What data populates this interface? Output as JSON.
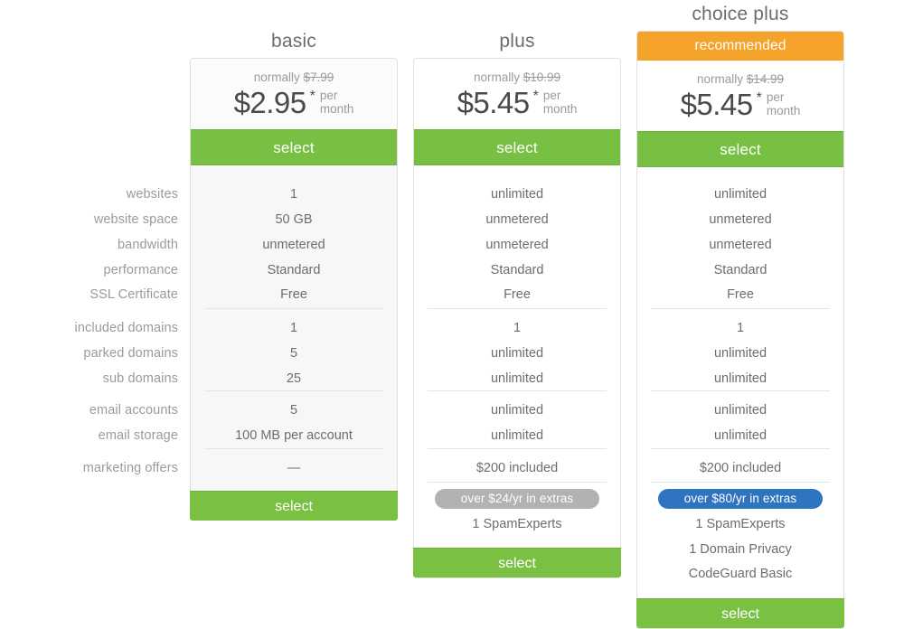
{
  "colors": {
    "green": "#78c043",
    "orange": "#f5a32a",
    "blue": "#2e74c0",
    "gray_badge": "#b2b2b2",
    "text": "#6d6d6d",
    "muted": "#9b9b9b"
  },
  "row_labels": [
    "websites",
    "website space",
    "bandwidth",
    "performance",
    "SSL Certificate",
    "included domains",
    "parked domains",
    "sub domains",
    "email accounts",
    "email storage",
    "marketing offers"
  ],
  "plans": {
    "basic": {
      "title": "basic",
      "recommended_label": null,
      "normally_prefix": "normally",
      "normally_price": "$7.99",
      "price": "$2.95",
      "asterisk": "*",
      "per": "per",
      "month": "month",
      "select_label": "select",
      "select_bottom_label": "select",
      "features": [
        "1",
        "50 GB",
        "unmetered",
        "Standard",
        "Free",
        "1",
        "5",
        "25",
        "5",
        "100 MB per account",
        "—"
      ],
      "extras_badge": null,
      "extras_items": []
    },
    "plus": {
      "title": "plus",
      "recommended_label": null,
      "normally_prefix": "normally",
      "normally_price": "$10.99",
      "price": "$5.45",
      "asterisk": "*",
      "per": "per",
      "month": "month",
      "select_label": "select",
      "select_bottom_label": "select",
      "features": [
        "unlimited",
        "unmetered",
        "unmetered",
        "Standard",
        "Free",
        "1",
        "unlimited",
        "unlimited",
        "unlimited",
        "unlimited",
        "$200 included"
      ],
      "extras_badge": "over $24/yr in extras",
      "extras_items": [
        "1 SpamExperts"
      ]
    },
    "choice_plus": {
      "title": "choice plus",
      "recommended_label": "recommended",
      "normally_prefix": "normally",
      "normally_price": "$14.99",
      "price": "$5.45",
      "asterisk": "*",
      "per": "per",
      "month": "month",
      "select_label": "select",
      "select_bottom_label": "select",
      "features": [
        "unlimited",
        "unmetered",
        "unmetered",
        "Standard",
        "Free",
        "1",
        "unlimited",
        "unlimited",
        "unlimited",
        "unlimited",
        "$200 included"
      ],
      "extras_badge": "over $80/yr in extras",
      "extras_items": [
        "1 SpamExperts",
        "1 Domain Privacy",
        "CodeGuard Basic"
      ]
    }
  }
}
